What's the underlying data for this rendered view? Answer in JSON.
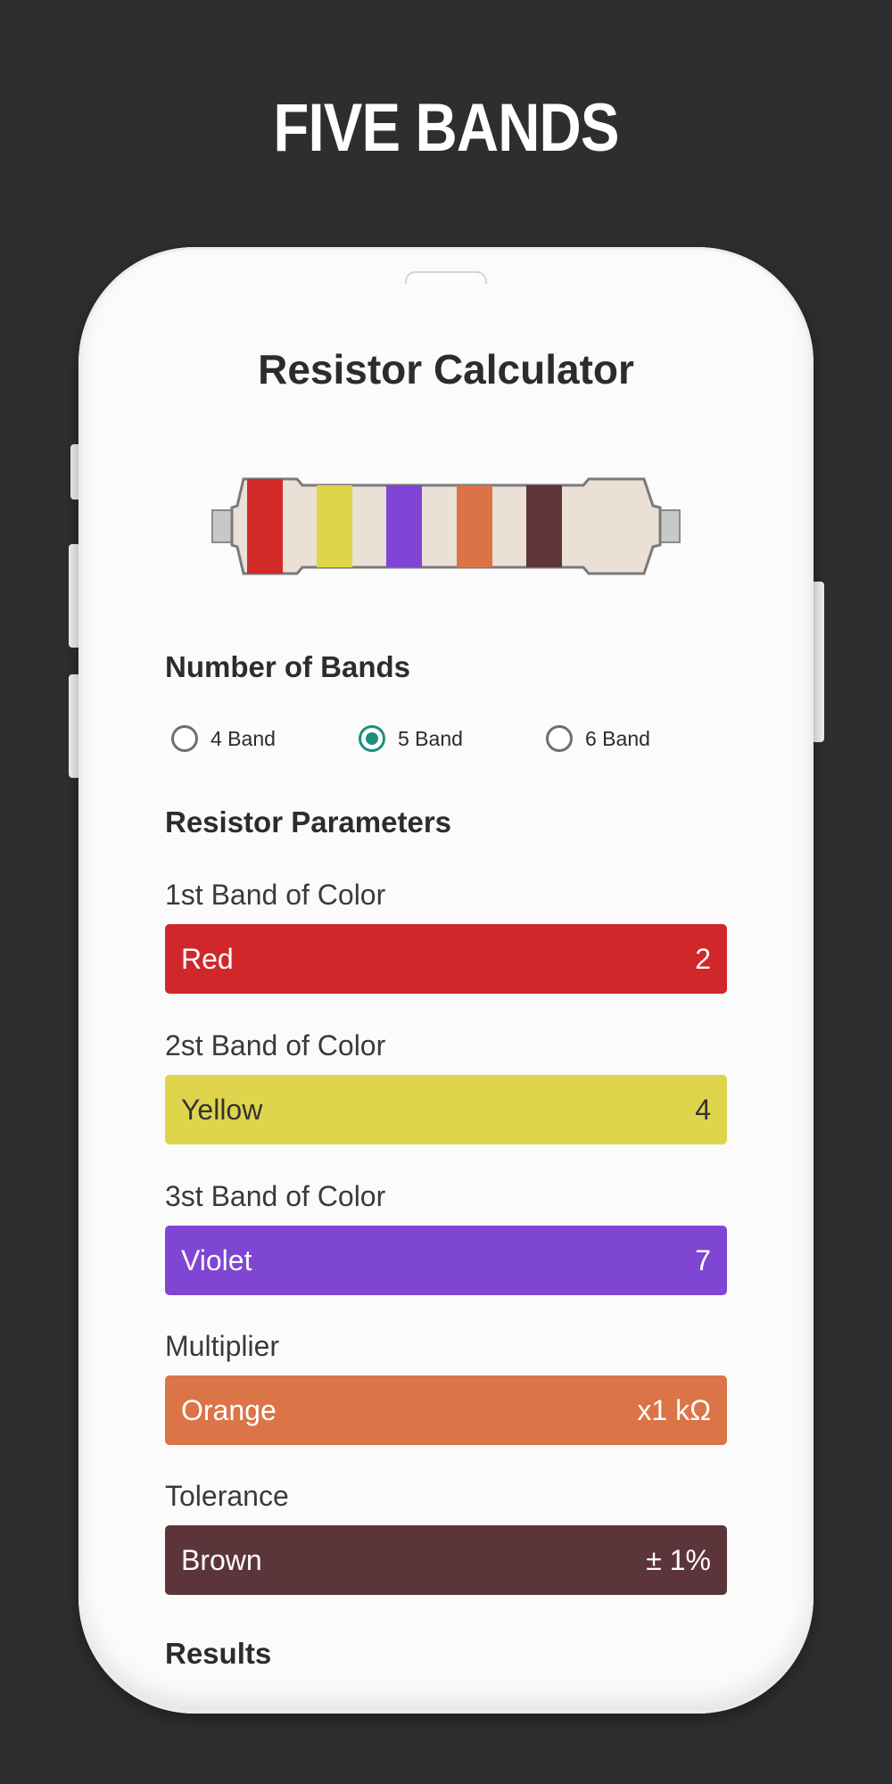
{
  "promo": {
    "headline": "FIVE BANDS"
  },
  "app": {
    "title": "Resistor Calculator"
  },
  "resistor": {
    "body_color": "#ebe0d6",
    "lead_color": "#c8c8c8",
    "band_colors": [
      "#d32a2a",
      "#ded54a",
      "#8045d4",
      "#dc7346",
      "#5e353a"
    ]
  },
  "bands_section": {
    "title": "Number of Bands",
    "options": [
      {
        "label": "4 Band",
        "selected": false
      },
      {
        "label": "5 Band",
        "selected": true
      },
      {
        "label": "6 Band",
        "selected": false
      }
    ]
  },
  "params_section": {
    "title": "Resistor Parameters",
    "fields": [
      {
        "label": "1st Band of Color",
        "color_name": "Red",
        "value": "2",
        "bg": "#d0282a",
        "fg": "#ffffff"
      },
      {
        "label": "2st Band of Color",
        "color_name": "Yellow",
        "value": "4",
        "bg": "#dfd54c",
        "fg": "#333333"
      },
      {
        "label": "3st Band of Color",
        "color_name": "Violet",
        "value": "7",
        "bg": "#7f45d3",
        "fg": "#ffffff"
      },
      {
        "label": "Multiplier",
        "color_name": "Orange",
        "value": "x1 kΩ",
        "bg": "#db7447",
        "fg": "#ffffff"
      },
      {
        "label": "Tolerance",
        "color_name": "Brown",
        "value": "± 1%",
        "bg": "#5c353a",
        "fg": "#ffffff"
      }
    ]
  },
  "results_section": {
    "title": "Results"
  }
}
